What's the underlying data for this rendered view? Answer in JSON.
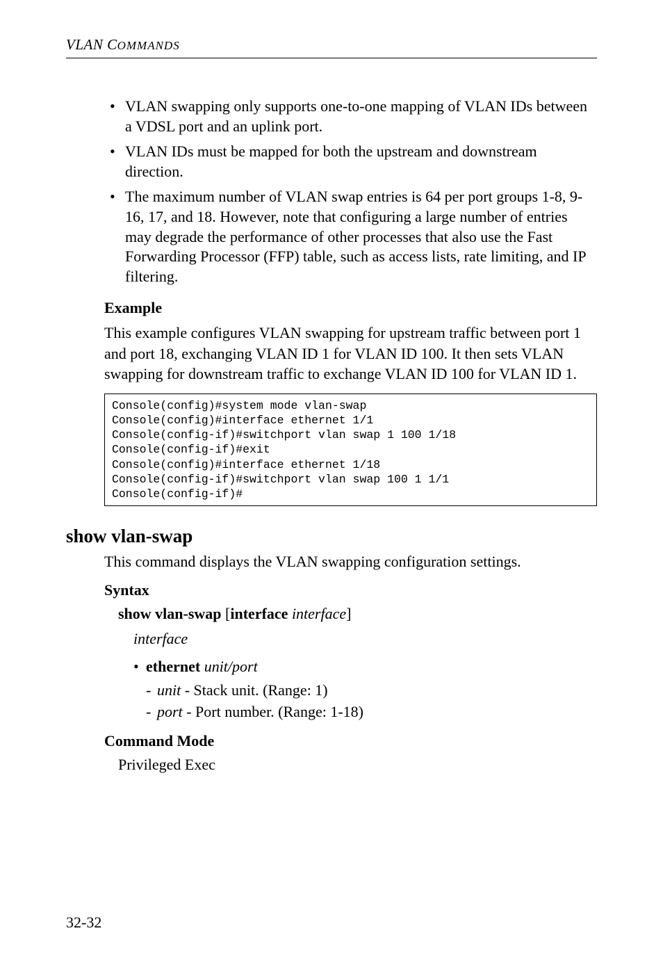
{
  "header": {
    "prefix": "VLAN C",
    "suffix": "OMMANDS"
  },
  "bullets_top": [
    "VLAN swapping only supports one-to-one mapping of VLAN IDs between a VDSL port and an uplink port.",
    "VLAN IDs must be mapped for both the upstream and downstream direction.",
    "The maximum number of VLAN swap entries is 64 per port groups 1-8, 9-16, 17, and 18. However, note that configuring a large number of entries may degrade the performance of other processes that also use the Fast Forwarding Processor (FFP) table, such as access lists, rate limiting, and IP filtering."
  ],
  "example": {
    "label": "Example",
    "desc": "This example configures VLAN swapping for upstream traffic between port 1 and port 18, exchanging VLAN ID 1 for VLAN ID 100. It then sets VLAN swapping for downstream traffic to exchange VLAN ID 100 for VLAN ID 1.",
    "code": "Console(config)#system mode vlan-swap\nConsole(config)#interface ethernet 1/1\nConsole(config-if)#switchport vlan swap 1 100 1/18\nConsole(config-if)#exit\nConsole(config)#interface ethernet 1/18\nConsole(config-if)#switchport vlan swap 100 1 1/1\nConsole(config-if)#"
  },
  "command": {
    "title": "show vlan-swap",
    "desc": "This command displays the VLAN swapping configuration settings."
  },
  "syntax": {
    "label": "Syntax",
    "cmd_bold1": "show vlan-swap",
    "open_bracket": " [",
    "cmd_bold2": "interface",
    "space": " ",
    "cmd_italic": "interface",
    "close_bracket": "]",
    "iface_word": "interface",
    "ethernet": {
      "kw": "ethernet",
      "args": "unit/port",
      "unit_i": "unit",
      "unit_rest": " - Stack unit. (Range: 1)",
      "port_i": "port",
      "port_rest": " - Port number. (Range: 1-18)"
    }
  },
  "cmd_mode": {
    "label": "Command Mode",
    "value": "Privileged Exec"
  },
  "page_number": "32-32"
}
